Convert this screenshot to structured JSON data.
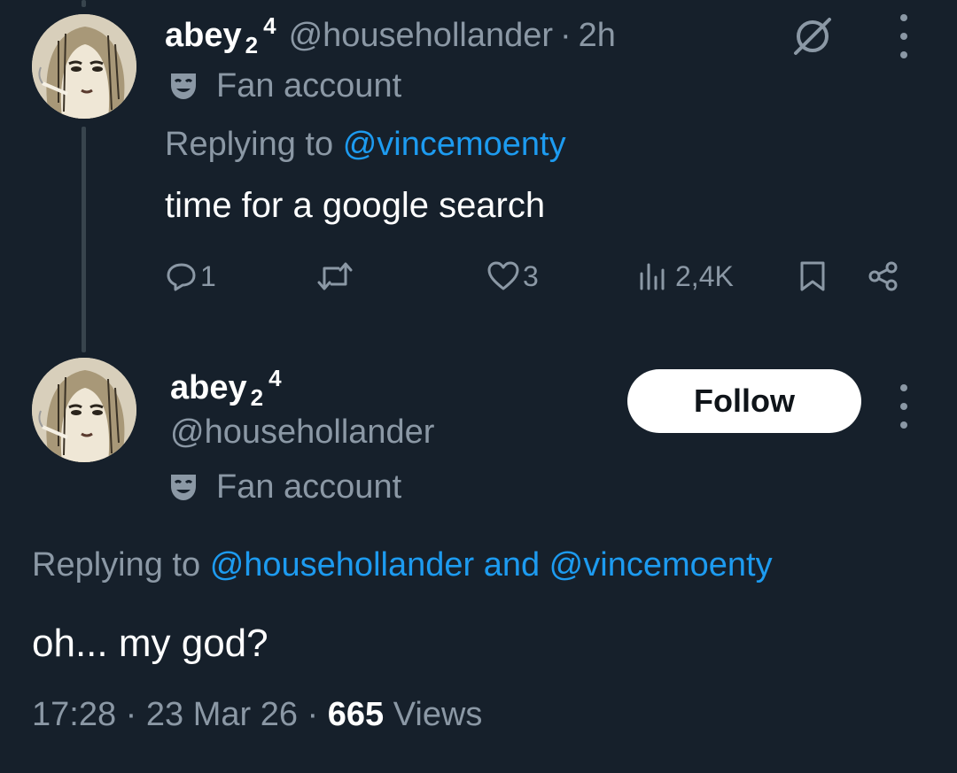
{
  "reply_tweet": {
    "display_name": "abey",
    "name_sub": "2",
    "name_sup": "4",
    "handle": "@househollander",
    "separator": "·",
    "time": "2h",
    "badge_label": "Fan account",
    "replying_prefix": "Replying to",
    "replying_to": "@vincemoenty",
    "text": "time for a google search",
    "metrics": {
      "replies": "1",
      "retweets": "",
      "likes": "3",
      "views": "2,4K"
    }
  },
  "main_tweet": {
    "display_name": "abey",
    "name_sub": "2",
    "name_sup": "4",
    "handle": "@househollander",
    "follow_label": "Follow",
    "badge_label": "Fan account",
    "replying_prefix": "Replying to",
    "replying_to_1": "@househollander",
    "replying_and": "and",
    "replying_to_2": "@vincemoenty",
    "text": "oh... my god?",
    "time": "17:28",
    "date": "23 Mar 26",
    "separator": "·",
    "views_count": "665",
    "views_label": "Views"
  },
  "colors": {
    "background": "#16202b",
    "accent": "#1d9bf0",
    "muted": "#8b98a5"
  },
  "icons": [
    "grok-icon",
    "more-icon",
    "comedy-mask-icon",
    "reply-icon",
    "retweet-icon",
    "like-icon",
    "views-icon",
    "bookmark-icon",
    "share-icon"
  ]
}
